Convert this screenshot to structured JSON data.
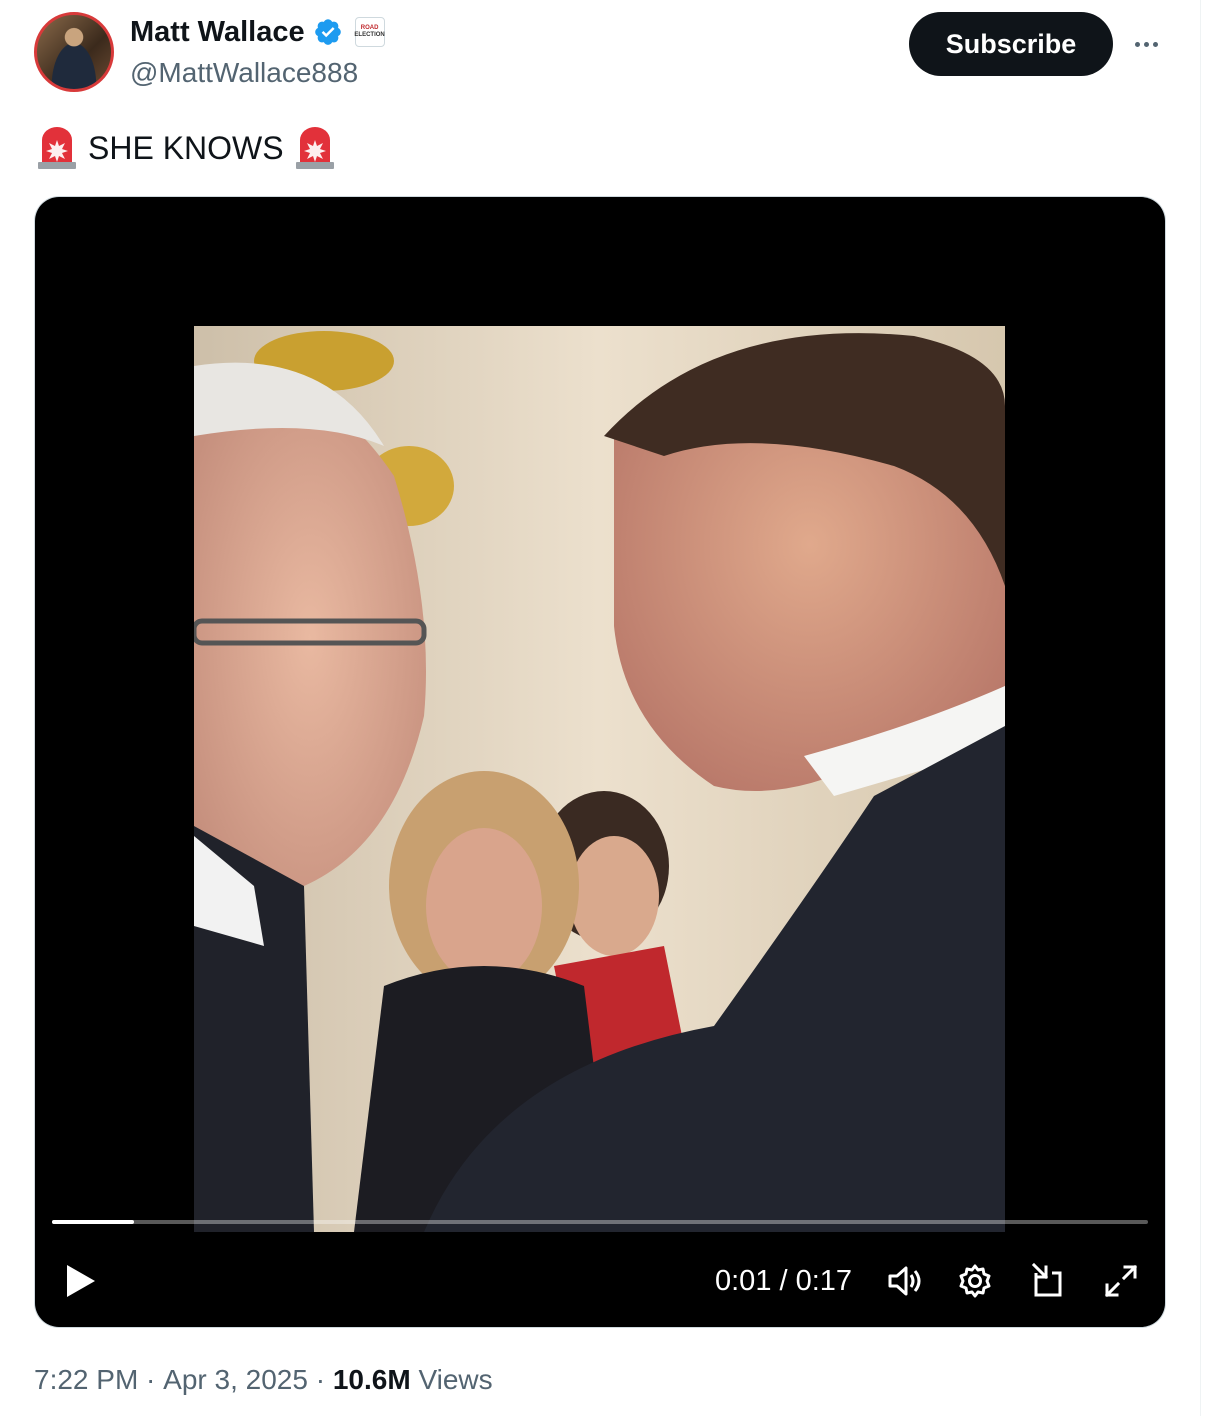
{
  "author": {
    "display_name": "Matt Wallace",
    "handle": "@MattWallace888",
    "verified": true,
    "affiliate_badge_text": [
      "ROAD",
      "ELECTION"
    ]
  },
  "actions": {
    "subscribe_label": "Subscribe",
    "more_icon": "more-horizontal-icon"
  },
  "tweet": {
    "text": "SHE KNOWS",
    "emoji_left": "rotating-light-icon",
    "emoji_right": "rotating-light-icon"
  },
  "video": {
    "current_time": "0:01",
    "duration": "0:17",
    "time_display": "0:01 / 0:17",
    "progress_fraction": 0.075,
    "controls": [
      "play-icon",
      "volume-icon",
      "settings-icon",
      "pip-icon",
      "fullscreen-icon"
    ]
  },
  "meta": {
    "time": "7:22 PM",
    "separator": " · ",
    "date": "Apr 3, 2025",
    "views_count": "10.6M",
    "views_label": " Views"
  },
  "colors": {
    "text_primary": "#0f1419",
    "text_secondary": "#536471",
    "verified_blue": "#1d9bf0",
    "button_dark": "#0f1419"
  }
}
